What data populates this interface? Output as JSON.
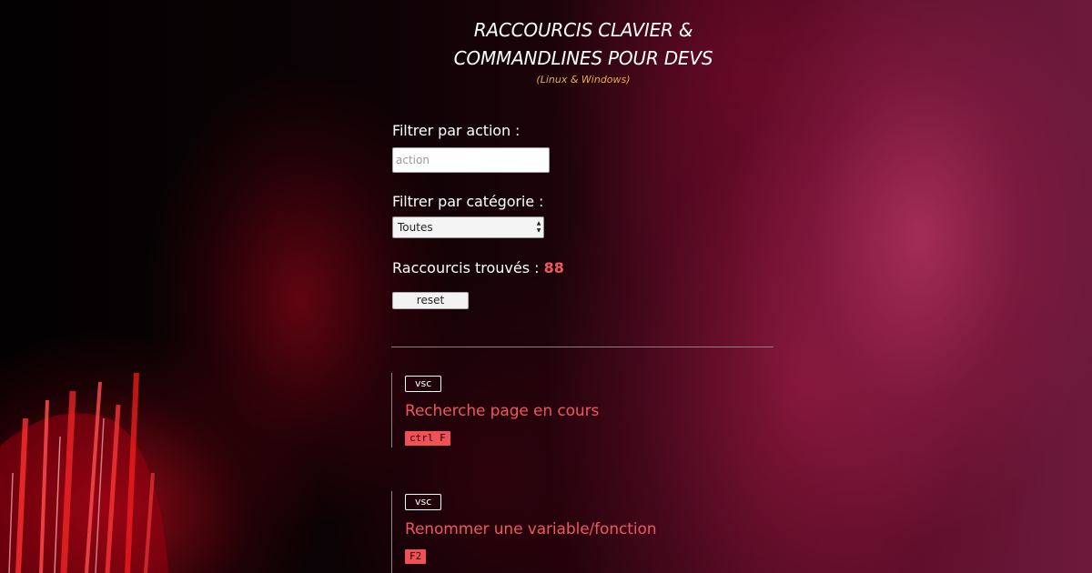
{
  "header": {
    "title_line1": "RACCOURCIS CLAVIER &",
    "title_line2": "COMMANDLINES POUR DEVS",
    "subtitle": "(Linux & Windows)"
  },
  "filters": {
    "action_label": "Filtrer par action :",
    "action_placeholder": "action",
    "action_value": "",
    "category_label": "Filtrer par catégorie :",
    "category_selected": "Toutes"
  },
  "results": {
    "count_label": "Raccourcis trouvés : ",
    "count": "88",
    "reset_label": "reset"
  },
  "shortcuts": [
    {
      "category": "vsc",
      "title": "Recherche page en cours",
      "keys": "ctrl F"
    },
    {
      "category": "vsc",
      "title": "Renommer une variable/fonction",
      "keys": "F2"
    }
  ],
  "colors": {
    "accent": "#f0575f",
    "subtitle": "#e3b04a",
    "kbd_background": "#ee5256"
  }
}
